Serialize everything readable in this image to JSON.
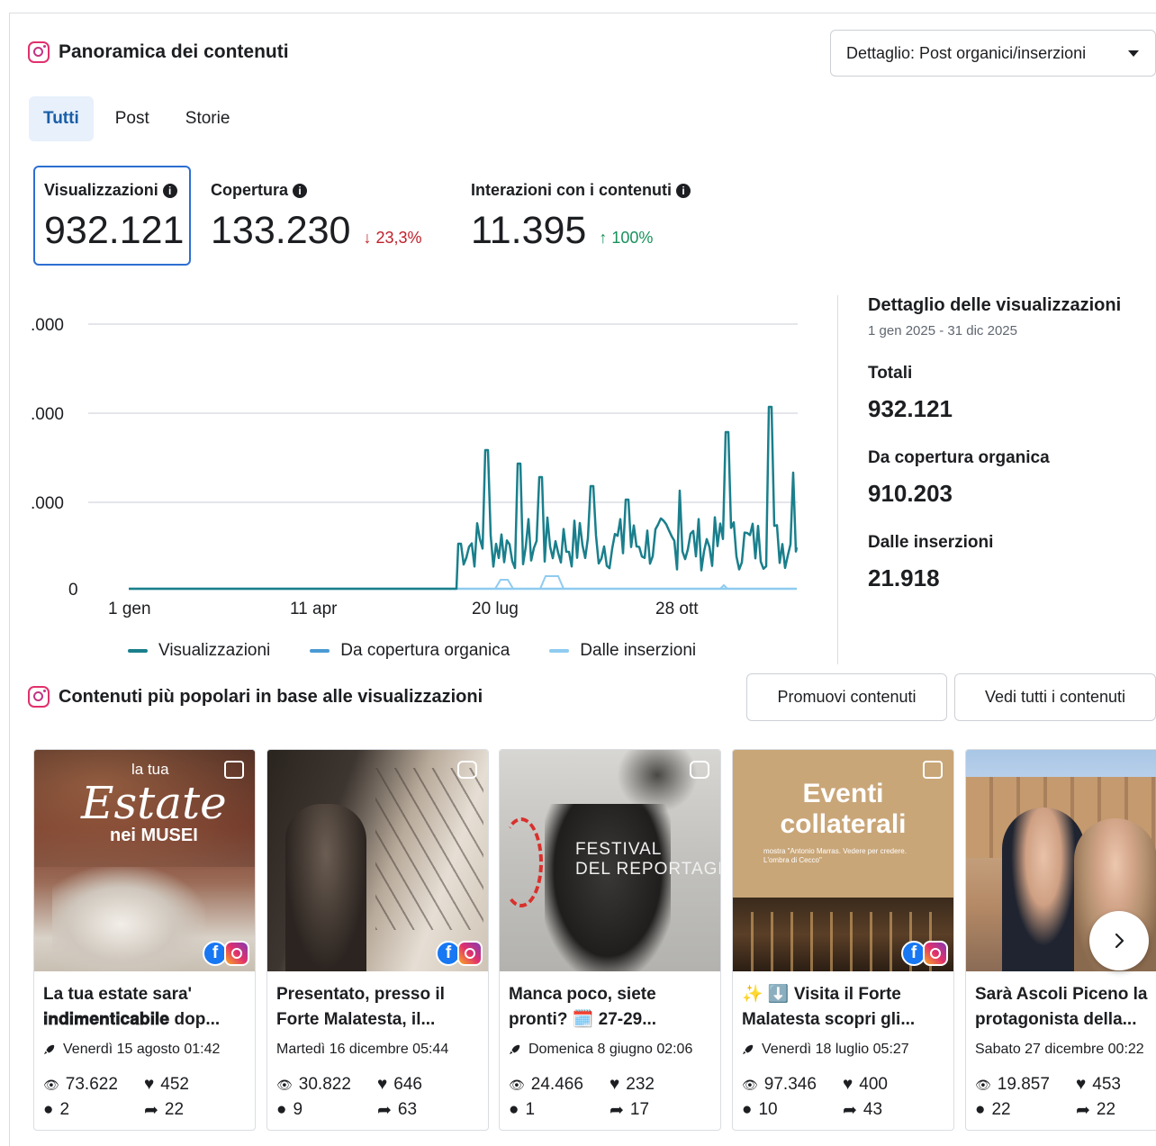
{
  "header": {
    "title": "Panoramica dei contenuti",
    "icon": "instagram-icon"
  },
  "detail_select": {
    "label": "Dettaglio: Post organici/inserzioni"
  },
  "tabs": [
    {
      "label": "Tutti",
      "active": true
    },
    {
      "label": "Post",
      "active": false
    },
    {
      "label": "Storie",
      "active": false
    }
  ],
  "metrics": {
    "views": {
      "label": "Visualizzazioni",
      "value": "932.121"
    },
    "reach": {
      "label": "Copertura",
      "value": "133.230",
      "delta": "23,3%",
      "direction": "down"
    },
    "interactions": {
      "label": "Interazioni con i contenuti",
      "value": "11.395",
      "delta": "100%",
      "direction": "up"
    }
  },
  "chart_data": {
    "type": "line",
    "y_ticks": [
      ".000",
      ".000",
      ".000",
      "0"
    ],
    "x_ticks": [
      "1 gen",
      "11 apr",
      "20 lug",
      "28 ott"
    ],
    "series": [
      {
        "name": "Visualizzazioni",
        "color": "#1a7f8c"
      },
      {
        "name": "Da copertura organica",
        "color": "#4a9ad4"
      },
      {
        "name": "Dalle inserzioni",
        "color": "#8fcbf0"
      }
    ],
    "x_range": [
      "1 gen 2025",
      "31 dic 2025"
    ],
    "views_activity_starts": "early July",
    "grid": true,
    "legend_position": "bottom"
  },
  "breakdown": {
    "title": "Dettaglio delle visualizzazioni",
    "range": "1 gen 2025 - 31 dic 2025",
    "total_label": "Totali",
    "total_value": "932.121",
    "organic_label": "Da copertura organica",
    "organic_value": "910.203",
    "ads_label": "Dalle inserzioni",
    "ads_value": "21.918"
  },
  "popular": {
    "title": "Contenuti più popolari in base alle visualizzazioni",
    "promote_label": "Promuovi contenuti",
    "view_all_label": "Vedi tutti i contenuti"
  },
  "cards": [
    {
      "caption": "La tua estate sara' 𝐢𝐧𝐝𝐢𝐦𝐞𝐧𝐭𝐢𝐜𝐚𝐛𝐢𝐥𝐞 dop...",
      "date": "Venerdì 15 agosto 01:42",
      "promoted": true,
      "views": "73.622",
      "likes": "452",
      "comments": "2",
      "shares": "22",
      "type_icon": "carousel-icon",
      "overlay_title": "la tua",
      "overlay_script": "Estate",
      "overlay_sub": "nei MUSEI"
    },
    {
      "caption": "Presentato, presso il Forte Malatesta, il...",
      "date": "Martedì 16 dicembre 05:44",
      "promoted": false,
      "views": "30.822",
      "likes": "646",
      "comments": "9",
      "shares": "63",
      "type_icon": "reel-icon"
    },
    {
      "caption": "Manca poco, siete pronti? 🗓️ 27-29...",
      "date": "Domenica 8 giugno 02:06",
      "promoted": true,
      "views": "24.466",
      "likes": "232",
      "comments": "1",
      "shares": "17",
      "type_icon": "reel-icon",
      "overlay_title": "FESTIVAL",
      "overlay_sub": "DEL REPORTAGE"
    },
    {
      "caption": "✨ ⬇️ Visita il Forte Malatesta scopri gli...",
      "date": "Venerdì 18 luglio 05:27",
      "promoted": true,
      "views": "97.346",
      "likes": "400",
      "comments": "10",
      "shares": "43",
      "type_icon": "carousel-icon",
      "overlay_title": "Eventi collaterali",
      "overlay_sub": "mostra \"Antonio Marras. Vedere per credere. L'ombra di Cecco\""
    },
    {
      "caption": "Sarà Ascoli Piceno la protagonista della...",
      "date": "Sabato 27 dicembre 00:22",
      "promoted": false,
      "views": "19.857",
      "likes": "453",
      "comments": "22",
      "shares": "22",
      "type_icon": "carousel-icon"
    }
  ]
}
